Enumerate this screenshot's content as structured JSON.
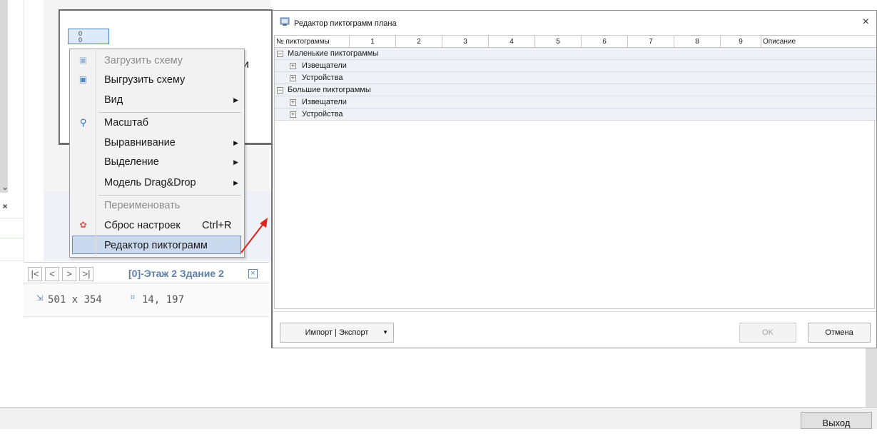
{
  "background": {
    "canvas_icon_text": "0\n0",
    "canvas_partial_text": "ки",
    "tab_label": "[0]-Этаж 2 Здание 2",
    "nav": {
      "first": "|<",
      "prev": "<",
      "next": ">",
      "last": ">|"
    },
    "size_value": "501 x 354",
    "position_value": "14, 197",
    "exit_button": "Выход"
  },
  "context_menu": {
    "items": [
      {
        "label": "Загрузить схему",
        "disabled": true,
        "icon": "load-schema-icon"
      },
      {
        "label": "Выгрузить схему",
        "disabled": false,
        "icon": "unload-schema-icon"
      },
      {
        "label": "Вид",
        "submenu": true
      },
      {
        "label": "Масштаб",
        "icon": "magnifier-icon"
      },
      {
        "label": "Выравнивание",
        "submenu": true
      },
      {
        "label": "Выделение",
        "submenu": true
      },
      {
        "label": "Модель Drag&Drop",
        "submenu": true
      },
      {
        "label": "Переименовать",
        "disabled": true
      },
      {
        "label": "Сброс настроек",
        "shortcut": "Ctrl+R",
        "icon": "reset-gear-icon"
      },
      {
        "label": "Редактор пиктограмм",
        "selected": true
      }
    ]
  },
  "dialog": {
    "title": "Редактор пиктограмм плана",
    "close": "×",
    "columns": [
      "№ пиктограммы",
      "1",
      "2",
      "3",
      "4",
      "5",
      "6",
      "7",
      "8",
      "9",
      "Описание"
    ],
    "rows": [
      {
        "label": "Маленькие пиктограммы",
        "level": 0,
        "expanded": true
      },
      {
        "label": "Извещатели",
        "level": 1,
        "expanded": false
      },
      {
        "label": "Устройства",
        "level": 1,
        "expanded": false
      },
      {
        "label": "Большие пиктограммы",
        "level": 0,
        "expanded": true
      },
      {
        "label": "Извещатели",
        "level": 1,
        "expanded": false
      },
      {
        "label": "Устройства",
        "level": 1,
        "expanded": false
      }
    ],
    "buttons": {
      "import_export": "Импорт | Экспорт",
      "ok": "OK",
      "cancel": "Отмена"
    }
  },
  "colors": {
    "selection": "#cbd9ef",
    "tab_accent": "#5d7fa8",
    "arrow": "#e0211c"
  }
}
